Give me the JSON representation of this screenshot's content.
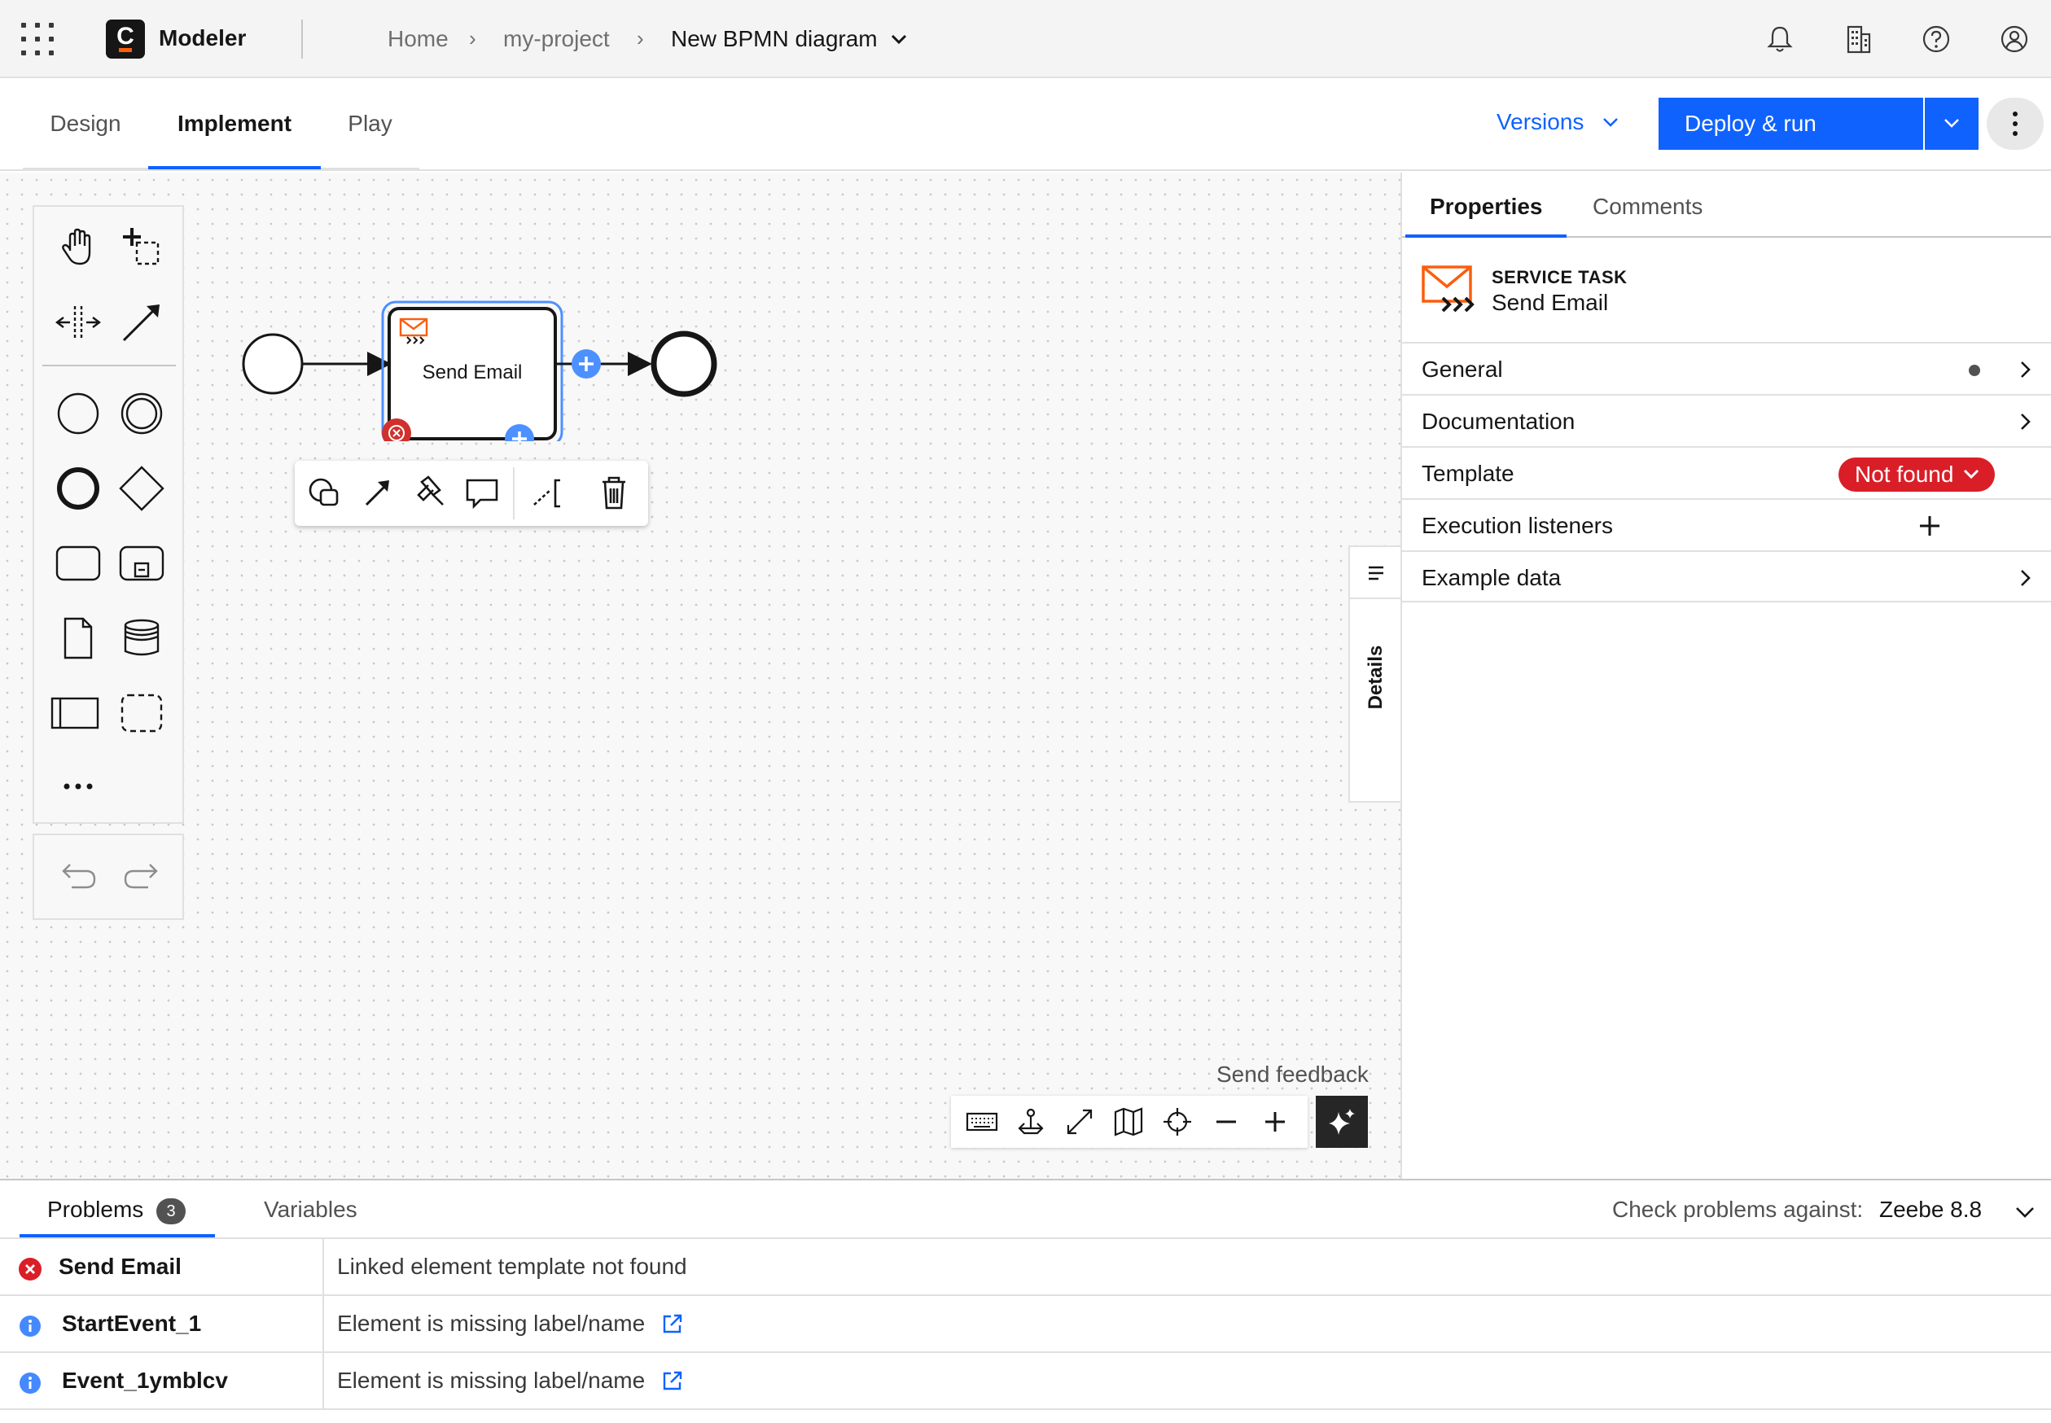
{
  "header": {
    "app_name": "Modeler",
    "logo_letter": "C",
    "breadcrumb": [
      "Home",
      "my-project"
    ],
    "breadcrumb_sep": "›",
    "current": "New BPMN diagram",
    "icons": [
      "notification-icon",
      "organization-icon",
      "help-icon",
      "user-icon"
    ]
  },
  "tabs": {
    "items": [
      "Design",
      "Implement",
      "Play"
    ],
    "active": "Implement",
    "versions_label": "Versions",
    "deploy_label": "Deploy & run"
  },
  "diagram": {
    "task_label": "Send Email",
    "colors": {
      "selection": "#4d90ff",
      "error": "#d0312d",
      "add": "#4d90ff"
    }
  },
  "canvas": {
    "feedback_label": "Send feedback"
  },
  "details_tab": {
    "label": "Details"
  },
  "properties": {
    "tabs": [
      "Properties",
      "Comments"
    ],
    "active_tab": "Properties",
    "element_type": "SERVICE TASK",
    "element_name": "Send Email",
    "groups": [
      {
        "label": "General",
        "indicator": "dot"
      },
      {
        "label": "Documentation",
        "indicator": "chevron"
      },
      {
        "label": "Template",
        "indicator": "badge",
        "badge": "Not found"
      },
      {
        "label": "Execution listeners",
        "indicator": "add"
      },
      {
        "label": "Example data",
        "indicator": "chevron"
      }
    ]
  },
  "bottom": {
    "tabs": [
      "Problems",
      "Variables"
    ],
    "problem_count": "3",
    "check_label": "Check problems against:",
    "check_value": "Zeebe 8.8",
    "problems": [
      {
        "severity": "error",
        "element": "Send Email",
        "message": "Linked element template not found",
        "link": false
      },
      {
        "severity": "info",
        "element": "StartEvent_1",
        "message": "Element is missing label/name",
        "link": true
      },
      {
        "severity": "info",
        "element": "Event_1ymblcv",
        "message": "Element is missing label/name",
        "link": true
      }
    ]
  }
}
